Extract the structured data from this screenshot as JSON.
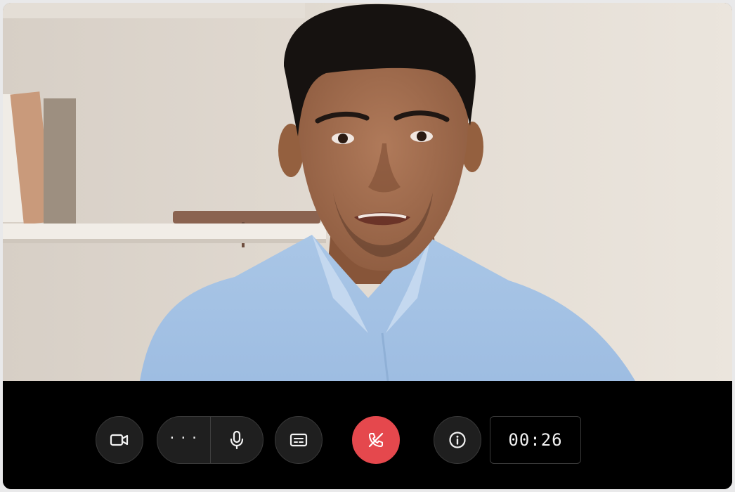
{
  "call": {
    "timer": "00:26"
  },
  "video": {
    "participant": "remote-participant"
  },
  "controls": {
    "camera_icon": "video-camera-icon",
    "more_icon": "more-options-icon",
    "more_label": "···",
    "mic_icon": "microphone-icon",
    "captions_icon": "captions-icon",
    "hangup_icon": "end-call-icon",
    "info_icon": "info-icon"
  },
  "colors": {
    "hangup": "#e5484d",
    "button_bg": "#1f1f1f",
    "control_bar": "#000000"
  }
}
